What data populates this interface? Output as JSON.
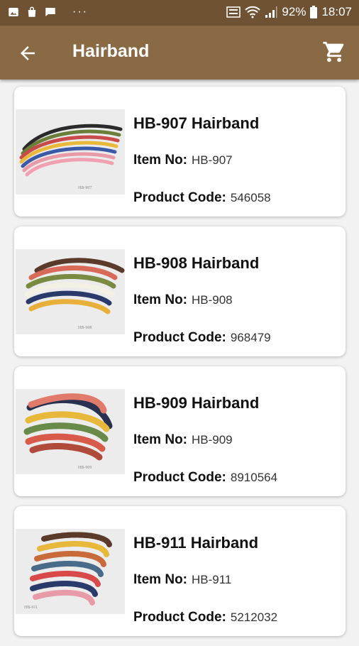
{
  "status_bar": {
    "battery": "92%",
    "time": "18:07",
    "dots": "···"
  },
  "app_bar": {
    "title": "Hairband"
  },
  "products": [
    {
      "name": "HB-907 Hairband",
      "item_label": "Item No:",
      "item_no": "HB-907",
      "code_label": "Product Code:",
      "code": "546058",
      "image_caption": "HB-907"
    },
    {
      "name": "HB-908 Hairband",
      "item_label": "Item No:",
      "item_no": "HB-908",
      "code_label": "Product Code:",
      "code": "968479",
      "image_caption": "HB-908"
    },
    {
      "name": "HB-909 Hairband",
      "item_label": "Item No:",
      "item_no": "HB-909",
      "code_label": "Product Code:",
      "code": "8910564",
      "image_caption": "HB-909"
    },
    {
      "name": "HB-911 Hairband",
      "item_label": "Item No:",
      "item_no": "HB-911",
      "code_label": "Product Code:",
      "code": "5212032",
      "image_caption": "HB-911"
    }
  ]
}
